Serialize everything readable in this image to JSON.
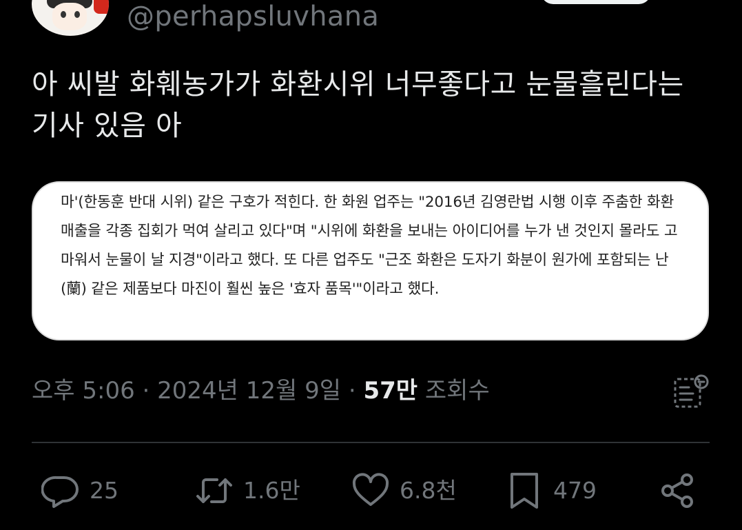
{
  "header": {
    "handle": "@perhapsluvhana"
  },
  "tweet": {
    "text": "아 씨발 화훼농가가 화환시위 너무좋다고 눈물흘린다는 기사 있음 아"
  },
  "snippet": {
    "text": "마'(한동훈 반대 시위) 같은 구호가 적힌다. 한 화원 업주는 \"2016년 김영란법 시행 이후 주춤한 화환 매출을 각종 집회가 먹여 살리고 있다\"며 \"시위에 화환을 보내는 아이디어를 누가 낸 것인지 몰라도 고마워서 눈물이 날 지경\"이라고 했다. 또 다른 업주도 \"근조 화환은 도자기 화분이 원가에 포함되는 난(蘭) 같은 제품보다 마진이 훨씬 높은 '효자 품목'\"이라고 했다."
  },
  "meta": {
    "time": "오후 5:06",
    "separator": " · ",
    "date": "2024년 12월 9일",
    "views_count": "57만",
    "views_label": "조회수"
  },
  "actions": {
    "replies": "25",
    "retweets": "1.6만",
    "likes": "6.8천",
    "bookmarks": "479"
  },
  "colors": {
    "background": "#000000",
    "text": "#e7e9ea",
    "muted": "#71767b",
    "divider": "#2f3336"
  }
}
